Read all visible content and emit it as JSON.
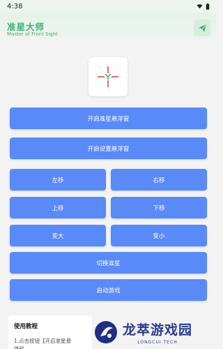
{
  "status_bar": {
    "time": "4:38"
  },
  "header": {
    "title": "准星大师",
    "subtitle": "Master of Front Sight",
    "accent_color": "#3db070",
    "share_icon": "paper-plane-icon"
  },
  "crosshair_preview": {
    "icon": "crosshair-icon",
    "line_color": "#e04a3a",
    "center_color": "#2e9e5a"
  },
  "buttons": {
    "open_crosshair_overlay": "开启准星悬浮窗",
    "open_settings_overlay": "开启设置悬浮窗",
    "move_left": "左移",
    "move_right": "右移",
    "move_up": "上移",
    "move_down": "下移",
    "enlarge": "变大",
    "shrink": "变小",
    "switch_crosshair": "切换准星",
    "launch_game": "启动游戏",
    "color": "#5a8af8"
  },
  "tutorial": {
    "title": "使用教程",
    "step1": "1.点击按钮【开启准星悬",
    "step1_cont": "体验"
  },
  "watermark": {
    "title": "龙萃游戏园",
    "subtitle": "LONGCUI TECH"
  }
}
